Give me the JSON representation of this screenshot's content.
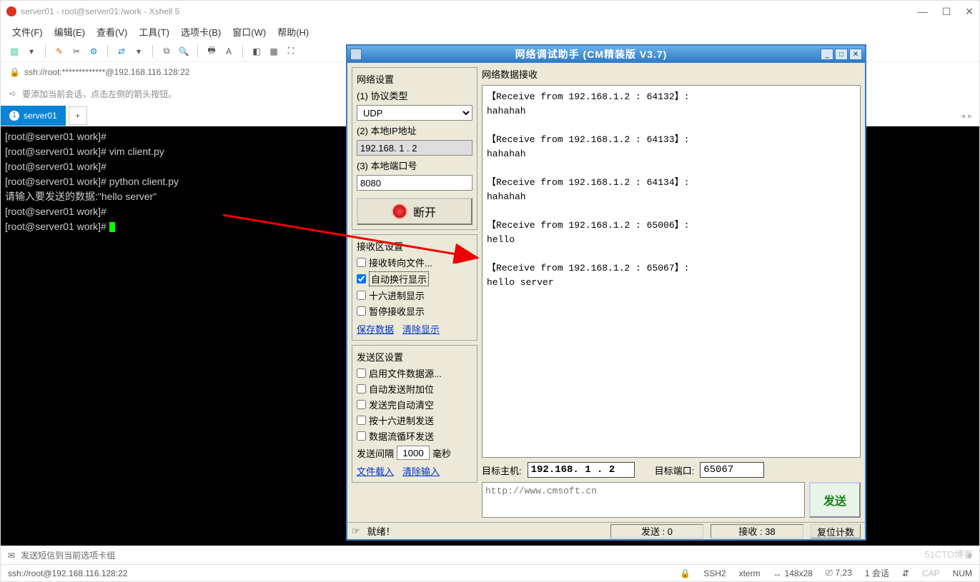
{
  "window": {
    "title": "server01 - root@server01:/work - Xshell 5"
  },
  "winButtons": {
    "min": "—",
    "max": "☐",
    "close": "✕"
  },
  "menu": {
    "file": "文件(F)",
    "edit": "编辑(E)",
    "view": "查看(V)",
    "tools": "工具(T)",
    "tabs": "选项卡(B)",
    "window": "窗口(W)",
    "help": "帮助(H)"
  },
  "address": {
    "icon": "🔒",
    "value": "ssh://root:*************@192.168.116.128:22"
  },
  "tip": {
    "text": "要添加当前会话，点击左侧的箭头按钮。"
  },
  "tab": {
    "num": "1",
    "label": "server01",
    "add": "+"
  },
  "terminal": {
    "l1": "[root@server01 work]#",
    "l2": "[root@server01 work]# vim client.py",
    "l3": "[root@server01 work]#",
    "l4": "[root@server01 work]# python client.py",
    "l5": "请输入要发送的数据:\"hello server\"",
    "l6": "[root@server01 work]#",
    "l7": "[root@server01 work]# "
  },
  "status1": {
    "text": "发送短信到当前选项卡组"
  },
  "status2": {
    "left": "ssh://root@192.168.116.128:22",
    "ssh": "SSH2",
    "term": "xterm",
    "size": "148x28",
    "pos": "7,23",
    "sess": "1 会话",
    "cap": "CAP",
    "num": "NUM"
  },
  "na": {
    "title": "网络调试助手 (CM精装版 V3.7)",
    "netSettings": "网络设置",
    "proto": {
      "label": "(1) 协议类型",
      "value": "UDP"
    },
    "ip": {
      "label": "(2) 本地IP地址",
      "value": "192.168. 1 . 2"
    },
    "port": {
      "label": "(3) 本地端口号",
      "value": "8080"
    },
    "disconnect": "断开",
    "recvSettings": "接收区设置",
    "recvToFile": "接收转向文件...",
    "autoWrap": "自动换行显示",
    "hexShow": "十六进制显示",
    "pauseRecv": "暂停接收显示",
    "saveData": "保存数据",
    "clearShow": "清除显示",
    "sendSettings": "发送区设置",
    "fileSource": "启用文件数据源...",
    "autoAppend": "自动发送附加位",
    "clearAfter": "发送完自动清空",
    "hexSend": "按十六进制发送",
    "loopSend": "数据流循环发送",
    "interval": {
      "label1": "发送间隔",
      "value": "1000",
      "label2": "毫秒"
    },
    "fileLoad": "文件载入",
    "clearInput": "清除输入",
    "recvLabel": "网络数据接收",
    "recvText": "【Receive from 192.168.1.2 : 64132】:\nhahahah\n\n【Receive from 192.168.1.2 : 64133】:\nhahahah\n\n【Receive from 192.168.1.2 : 64134】:\nhahahah\n\n【Receive from 192.168.1.2 : 65006】:\nhello\n\n【Receive from 192.168.1.2 : 65067】:\nhello server",
    "targetHost": {
      "label": "目标主机:",
      "value": "192.168. 1 . 2"
    },
    "targetPort": {
      "label": "目标端口:",
      "value": "65067"
    },
    "sendInput": "http://www.cmsoft.cn",
    "sendBtn": "发送",
    "ready": "就绪！",
    "sendCount": "发送 : 0",
    "recvCount": "接收 : 38",
    "resetCount": "复位计数"
  },
  "watermark": "51CTO博客"
}
